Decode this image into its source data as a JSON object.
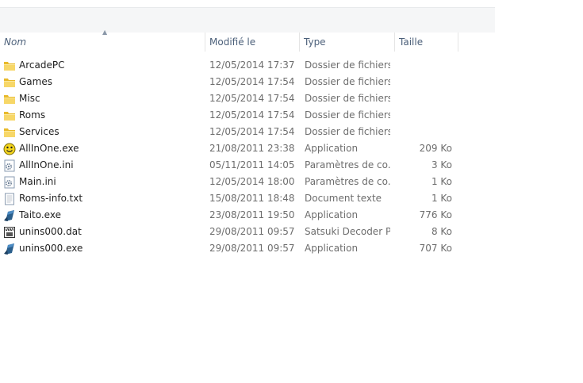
{
  "columns": {
    "name": "Nom",
    "modified": "Modifié le",
    "type": "Type",
    "size": "Taille"
  },
  "files": [
    {
      "name": "ArcadePC",
      "modified": "12/05/2014 17:37",
      "type": "Dossier de fichiers",
      "size": "",
      "icon": "folder-icon"
    },
    {
      "name": "Games",
      "modified": "12/05/2014 17:54",
      "type": "Dossier de fichiers",
      "size": "",
      "icon": "folder-icon"
    },
    {
      "name": "Misc",
      "modified": "12/05/2014 17:54",
      "type": "Dossier de fichiers",
      "size": "",
      "icon": "folder-icon"
    },
    {
      "name": "Roms",
      "modified": "12/05/2014 17:54",
      "type": "Dossier de fichiers",
      "size": "",
      "icon": "folder-icon"
    },
    {
      "name": "Services",
      "modified": "12/05/2014 17:54",
      "type": "Dossier de fichiers",
      "size": "",
      "icon": "folder-icon"
    },
    {
      "name": "AllInOne.exe",
      "modified": "21/08/2011 23:38",
      "type": "Application",
      "size": "209 Ko",
      "icon": "smiley-app-icon"
    },
    {
      "name": "AllInOne.ini",
      "modified": "05/11/2011 14:05",
      "type": "Paramètres de co...",
      "size": "3 Ko",
      "icon": "settings-file-icon"
    },
    {
      "name": "Main.ini",
      "modified": "12/05/2014 18:00",
      "type": "Paramètres de co...",
      "size": "1 Ko",
      "icon": "settings-file-icon"
    },
    {
      "name": "Roms-info.txt",
      "modified": "15/08/2011 18:48",
      "type": "Document texte",
      "size": "1 Ko",
      "icon": "text-file-icon"
    },
    {
      "name": "Taito.exe",
      "modified": "23/08/2011 19:50",
      "type": "Application",
      "size": "776 Ko",
      "icon": "installer-app-icon"
    },
    {
      "name": "unins000.dat",
      "modified": "29/08/2011 09:57",
      "type": "Satsuki Decoder P...",
      "size": "8 Ko",
      "icon": "media-file-icon"
    },
    {
      "name": "unins000.exe",
      "modified": "29/08/2011 09:57",
      "type": "Application",
      "size": "707 Ko",
      "icon": "installer-app-icon"
    }
  ]
}
